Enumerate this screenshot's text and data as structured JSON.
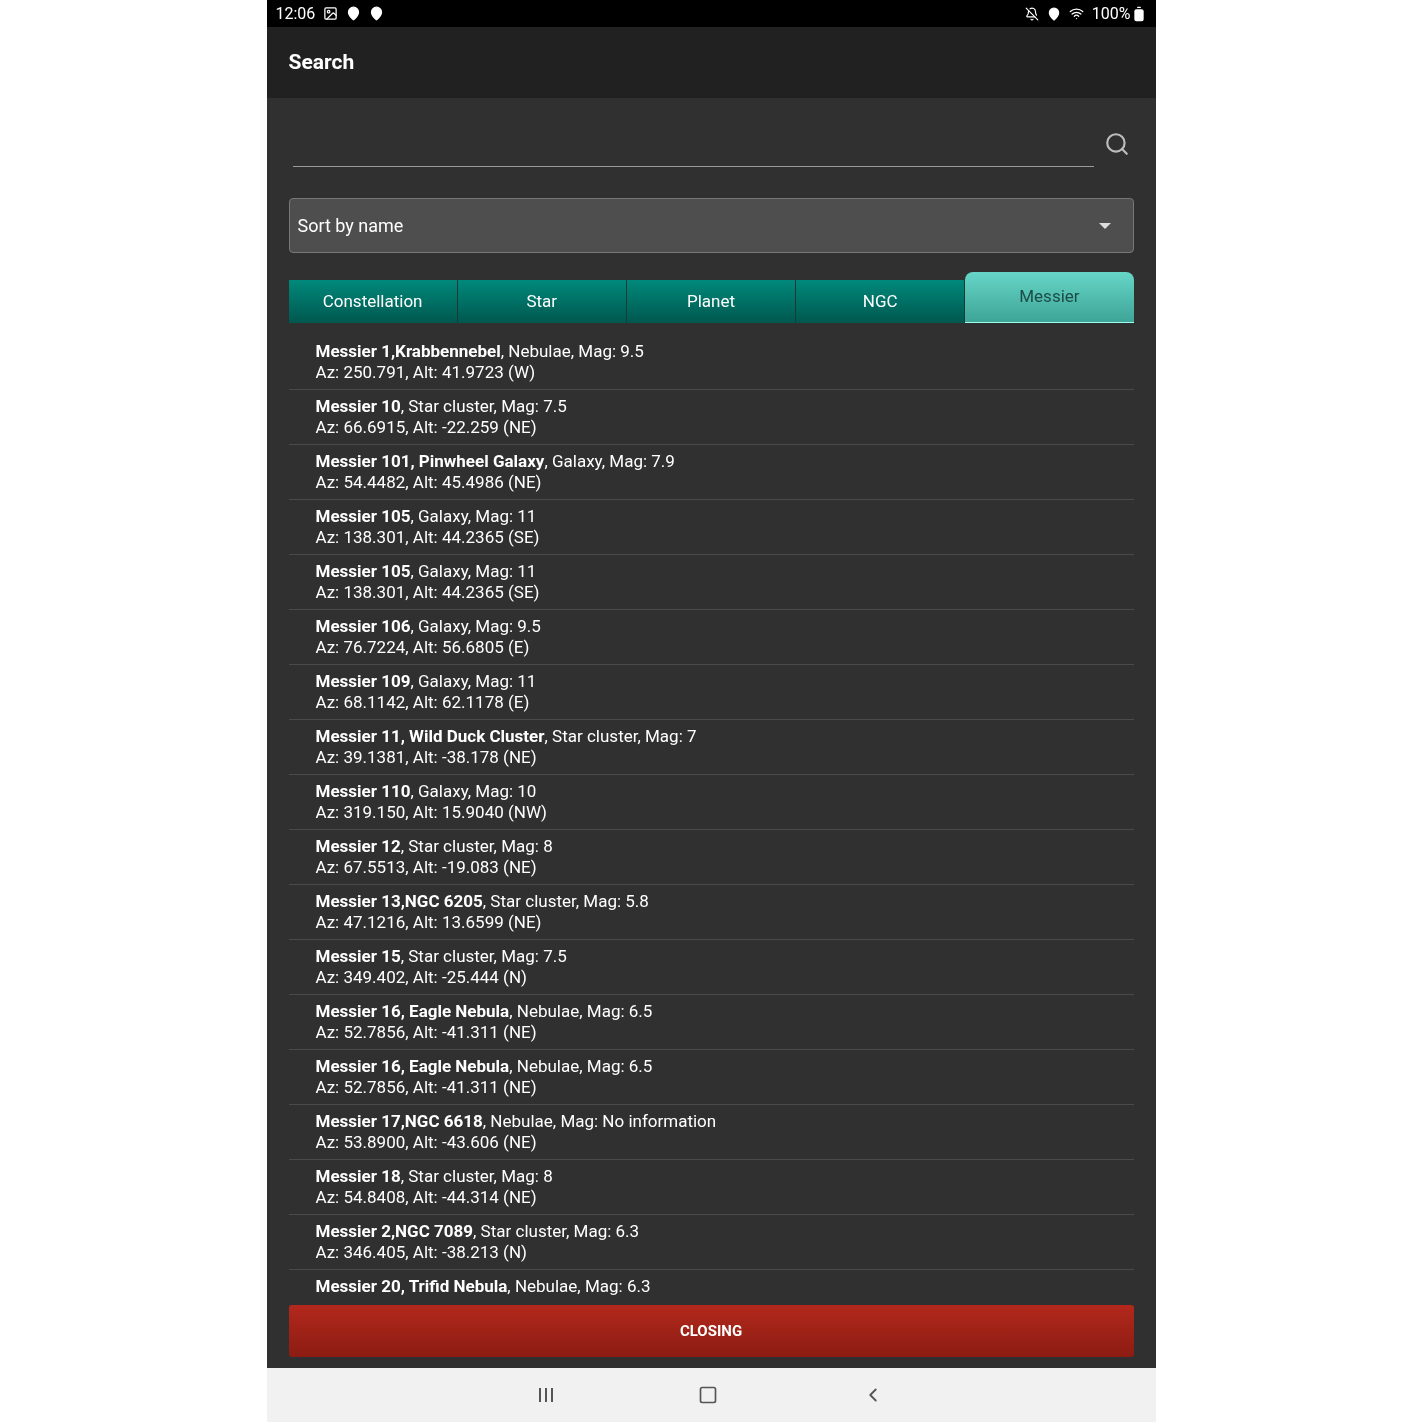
{
  "status_bar": {
    "time": "12:06",
    "battery": "100%"
  },
  "app_bar": {
    "title": "Search"
  },
  "sort": {
    "value": "Sort by name"
  },
  "tabs": [
    {
      "label": "Constellation",
      "selected": false
    },
    {
      "label": "Star",
      "selected": false
    },
    {
      "label": "Planet",
      "selected": false
    },
    {
      "label": "NGC",
      "selected": false
    },
    {
      "label": "Messier",
      "selected": true
    }
  ],
  "results": [
    {
      "title": "**Messier 1,Krabbennebel**, Nebulae, Mag: 9.5",
      "position": "Az: 250.791, Alt: 41.9723 (W)"
    },
    {
      "title": "**Messier 10**, Star cluster, Mag: 7.5",
      "position": "Az: 66.6915, Alt: -22.259 (NE)"
    },
    {
      "title": "**Messier 101, Pinwheel Galaxy**, Galaxy, Mag: 7.9",
      "position": "Az: 54.4482, Alt: 45.4986 (NE)"
    },
    {
      "title": "**Messier 105**, Galaxy, Mag: 11",
      "position": "Az: 138.301, Alt: 44.2365 (SE)"
    },
    {
      "title": "**Messier 105**, Galaxy, Mag: 11",
      "position": "Az: 138.301, Alt: 44.2365 (SE)"
    },
    {
      "title": "**Messier 106**, Galaxy, Mag: 9.5",
      "position": "Az: 76.7224, Alt: 56.6805 (E)"
    },
    {
      "title": "**Messier 109**, Galaxy, Mag: 11",
      "position": "Az: 68.1142, Alt: 62.1178 (E)"
    },
    {
      "title": "**Messier 11, Wild Duck Cluster**, Star cluster, Mag: 7",
      "position": "Az: 39.1381, Alt: -38.178 (NE)"
    },
    {
      "title": "**Messier 110**, Galaxy, Mag: 10",
      "position": "Az: 319.150, Alt: 15.9040 (NW)"
    },
    {
      "title": "**Messier 12**, Star cluster, Mag: 8",
      "position": "Az: 67.5513, Alt: -19.083 (NE)"
    },
    {
      "title": "**Messier 13,NGC 6205**, Star cluster, Mag: 5.8",
      "position": "Az: 47.1216, Alt: 13.6599 (NE)"
    },
    {
      "title": "**Messier 15**, Star cluster, Mag: 7.5",
      "position": "Az: 349.402, Alt: -25.444 (N)"
    },
    {
      "title": "**Messier 16, Eagle Nebula**, Nebulae, Mag: 6.5",
      "position": "Az: 52.7856, Alt: -41.311 (NE)"
    },
    {
      "title": "**Messier 16, Eagle Nebula**, Nebulae, Mag: 6.5",
      "position": "Az: 52.7856, Alt: -41.311 (NE)"
    },
    {
      "title": "**Messier 17,NGC 6618**, Nebulae, Mag: No information",
      "position": "Az: 53.8900, Alt: -43.606 (NE)"
    },
    {
      "title": "**Messier 18**, Star cluster, Mag: 8",
      "position": "Az: 54.8408, Alt: -44.314 (NE)"
    },
    {
      "title": "**Messier 2,NGC 7089**, Star cluster, Mag: 6.3",
      "position": "Az: 346.405, Alt: -38.213 (N)"
    },
    {
      "title": "**Messier 20, Trifid Nebula**, Nebulae, Mag: 6.3"
    }
  ],
  "close_button": {
    "label": "CLOSING"
  }
}
